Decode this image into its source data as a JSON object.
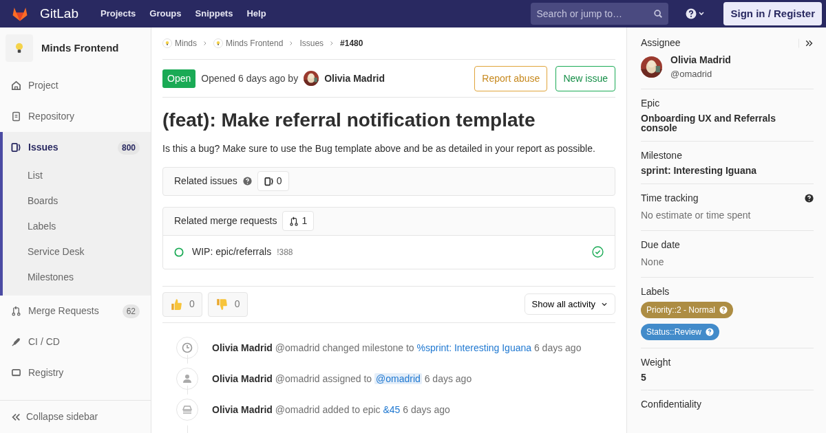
{
  "navbar": {
    "brand": "GitLab",
    "links": [
      "Projects",
      "Groups",
      "Snippets",
      "Help"
    ],
    "search": {
      "placeholder": "Search or jump to…"
    },
    "sign_in": "Sign in / Register"
  },
  "sidebar": {
    "project": "Minds Frontend",
    "items": [
      {
        "label": "Project",
        "selected": false
      },
      {
        "label": "Repository",
        "selected": false
      },
      {
        "label": "Issues",
        "count": "800",
        "selected": true,
        "expanded": true,
        "children": [
          {
            "label": "List"
          },
          {
            "label": "Boards"
          },
          {
            "label": "Labels"
          },
          {
            "label": "Service Desk"
          },
          {
            "label": "Milestones"
          }
        ]
      },
      {
        "label": "Merge Requests",
        "count": "62",
        "selected": false
      },
      {
        "label": "CI / CD",
        "selected": false
      },
      {
        "label": "Registry",
        "selected": false
      }
    ],
    "collapse": "Collapse sidebar"
  },
  "breadcrumbs": [
    {
      "label": "Minds",
      "avatar": true
    },
    {
      "label": "Minds Frontend",
      "avatar": true
    },
    {
      "label": "Issues",
      "avatar": false
    },
    {
      "label": "#1480",
      "avatar": false
    }
  ],
  "issue": {
    "status": "Open",
    "opened": "Opened 6 days ago by",
    "author": "Olivia Madrid",
    "report": "Report abuse",
    "new_issue": "New issue",
    "title": "(feat): Make referral notification template",
    "description": "Is this a bug? Make sure to use the Bug template above and be as detailed in your report as possible."
  },
  "related_issues": {
    "title": "Related issues",
    "count": "0"
  },
  "related_mrs": {
    "title": "Related merge requests",
    "count": "1",
    "items": [
      {
        "title": "WIP: epic/referrals",
        "ref": "!388"
      }
    ]
  },
  "awards": [
    {
      "kind": "up",
      "count": "0"
    },
    {
      "kind": "down",
      "count": "0"
    }
  ],
  "activity_filter": "Show all activity",
  "activity": [
    {
      "kind": "reference",
      "author": "Olivia Madrid",
      "handle": "@omadrid",
      "action": "changed milestone to",
      "link": "%sprint: Interesting Iguana",
      "time": "6 days ago"
    },
    {
      "kind": "mention",
      "author": "Olivia Madrid",
      "handle": "@omadrid",
      "action": "assigned to",
      "link": "@omadrid",
      "time": "6 days ago"
    },
    {
      "kind": "reference",
      "author": "Olivia Madrid",
      "handle": "@omadrid",
      "action": "added to epic",
      "link": "&45",
      "time": "6 days ago"
    }
  ],
  "right_sidebar": {
    "assignee": {
      "label": "Assignee",
      "name": "Olivia Madrid",
      "handle": "@omadrid"
    },
    "blocks": [
      {
        "kind": "bold",
        "label": "Epic",
        "value": "Onboarding UX and Referrals console"
      },
      {
        "kind": "bold",
        "label": "Milestone",
        "value": "sprint: Interesting Iguana"
      },
      {
        "kind": "muted",
        "label": "Time tracking",
        "value": "No estimate or time spent",
        "help": true
      },
      {
        "kind": "muted",
        "label": "Due date",
        "value": "None"
      },
      {
        "kind": "labels",
        "label": "Labels",
        "labels": [
          {
            "text": "Priority::2 - Normal",
            "color": "#ad8d43"
          },
          {
            "text": "Status::Review",
            "color": "#428bca"
          }
        ]
      },
      {
        "kind": "bold",
        "label": "Weight",
        "value": "5"
      },
      {
        "kind": "title",
        "label": "Confidentiality"
      }
    ]
  }
}
